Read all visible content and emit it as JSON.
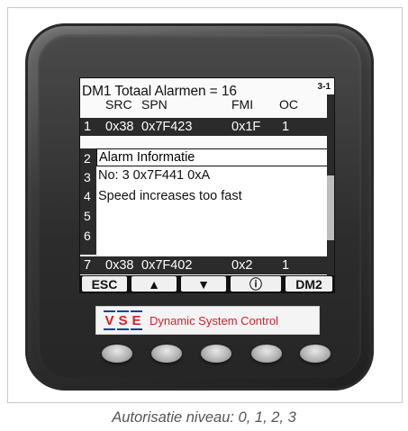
{
  "screen": {
    "title": "DM1  Totaal Alarmen = 16",
    "page": "3-1",
    "columns": [
      "SRC",
      "SPN",
      "FMI",
      "OC"
    ],
    "rows": [
      {
        "num": "1",
        "src": "0x38",
        "spn": "0x7F423",
        "fmi": "0x1F",
        "oc": "1"
      },
      {
        "num": "7",
        "src": "0x38",
        "spn": "0x7F402",
        "fmi": "0x2",
        "oc": "1"
      }
    ],
    "gutter_numbers": [
      "2",
      "3",
      "4",
      "5",
      "6"
    ],
    "popup": {
      "title": "Alarm  Informatie",
      "line1": "No:  3  0x7F441 0xA",
      "line2": "Speed increases too fast"
    },
    "softkeys": [
      "ESC",
      "▲",
      "▼",
      "ⓘ",
      "DM2"
    ],
    "scroll_position": 0.5
  },
  "brand": {
    "letters": [
      "V",
      "S",
      "E"
    ],
    "text": "Dynamic System Control"
  },
  "hardware_buttons": 5,
  "caption": "Autorisatie niveau: 0, 1, 2, 3",
  "colors": {
    "screen_dark": "#2b2b2b",
    "screen_light": "#fafafa",
    "brand_red": "#d91e27",
    "brand_blue": "#1b3fa0"
  }
}
